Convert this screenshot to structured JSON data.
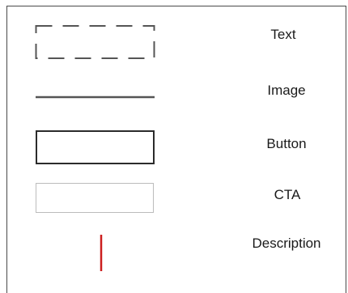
{
  "legend": {
    "items": [
      {
        "label": "Text",
        "style": "dashed-box",
        "color": "#555555"
      },
      {
        "label": "Image",
        "style": "horizontal-line",
        "color": "#555555"
      },
      {
        "label": "Button",
        "style": "solid-box",
        "color": "#2b2b2b"
      },
      {
        "label": "CTA",
        "style": "thin-box",
        "color": "#bcbcbc"
      },
      {
        "label": "Description",
        "style": "vertical-line",
        "color": "#cc1f1f"
      }
    ]
  }
}
